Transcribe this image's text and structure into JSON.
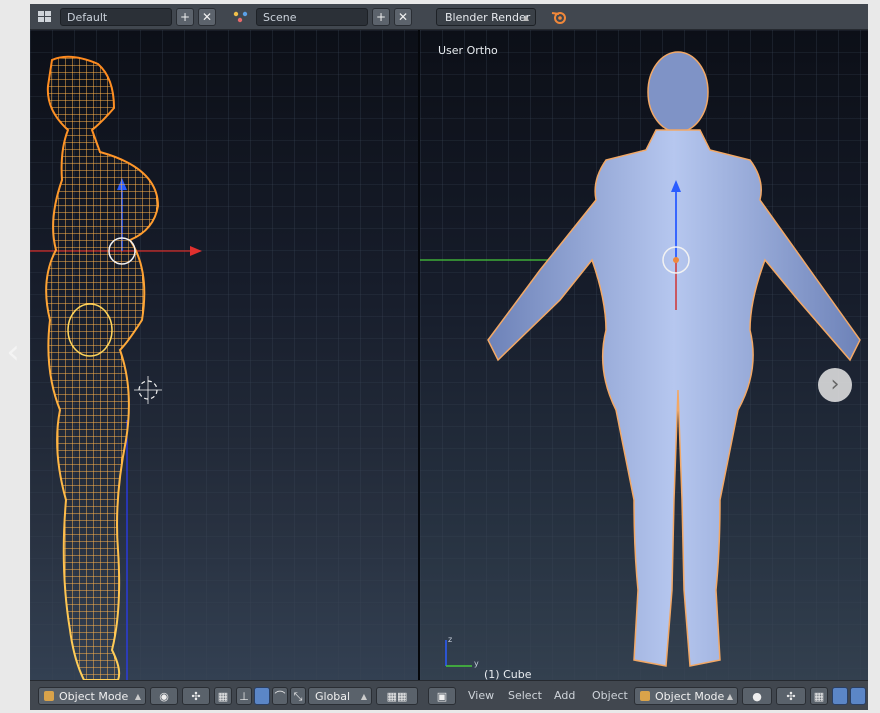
{
  "top_header": {
    "screen_layout": "Default",
    "scene": "Scene",
    "render_engine": "Blender Render",
    "add_label": "+",
    "close_label": "✕"
  },
  "viewport_right": {
    "view_label": "User Ortho",
    "object_label": "(1) Cube"
  },
  "bottom_left": {
    "mode": "Object Mode",
    "orientation": "Global"
  },
  "bottom_right": {
    "menus": [
      "View",
      "Select",
      "Add",
      "Object"
    ],
    "mode": "Object Mode"
  },
  "axes": {
    "x_color": "#e0302e",
    "y_color": "#4ad13a",
    "z_color": "#2a5cff"
  },
  "colors": {
    "wireframe": "#ffa23a",
    "mesh": "#9db3e6",
    "header": "#41474f"
  },
  "nav": {
    "prev_icon": "chevron-left-icon",
    "next_icon": "chevron-right-icon"
  }
}
